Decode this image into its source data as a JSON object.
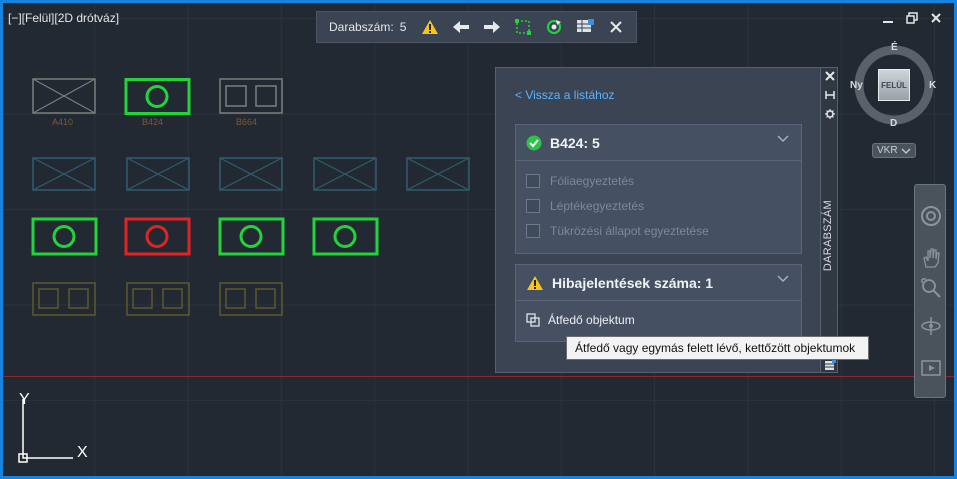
{
  "viewport": {
    "label": "[−][Felül][2D drótváz]"
  },
  "count_toolbar": {
    "label": "Darabszám:",
    "value": "5",
    "buttons": [
      "warning-icon",
      "arrow-left-icon",
      "arrow-right-icon",
      "zoom-object-icon",
      "refresh-icon",
      "insert-table-icon",
      "close-icon"
    ]
  },
  "blocks": {
    "labels": [
      "A410",
      "B424",
      "B664"
    ]
  },
  "viewcube": {
    "north": "É",
    "south": "D",
    "east": "K",
    "west": "Ny",
    "face": "FELÜL",
    "ucs_menu": "VKR"
  },
  "palette": {
    "back_link": "< Vissza a listához",
    "side_title": "DARABSZÁM",
    "count_card": {
      "title": "B424: 5",
      "options": [
        "Fóliaegyeztetés",
        "Léptékegyeztetés",
        "Tükrözési állapot egyeztetése"
      ]
    },
    "error_card": {
      "title": "Hibajelentések száma: 1",
      "item": "Átfedő objektum"
    }
  },
  "tooltip": {
    "text": "Átfedő vagy egymás felett lévő, kettőzött objektumok"
  },
  "ucs": {
    "x_label": "X",
    "y_label": "Y"
  },
  "colors": {
    "accent_border": "#1783e0",
    "highlight_green": "#22d43a",
    "error_red": "#e02424",
    "link_blue": "#5ab4ff",
    "warning_yellow": "#f5c518"
  }
}
